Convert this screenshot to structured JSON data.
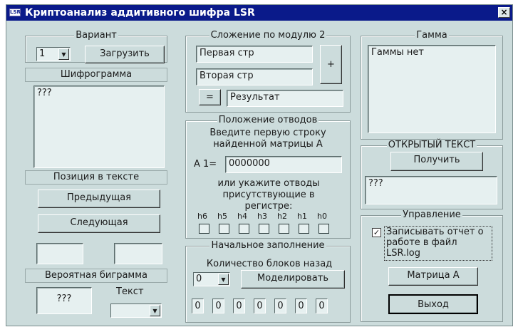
{
  "window": {
    "title": "Криптоанализ аддитивного шифра LSR",
    "icon_label": "LSR",
    "close_glyph": "×"
  },
  "variant": {
    "group_title": "Вариант",
    "selected": "1",
    "load_button": "Загрузить"
  },
  "ciphertext": {
    "label": "Шифрограмма",
    "value": "???"
  },
  "position": {
    "label": "Позиция в тексте",
    "prev_button": "Предыдущая",
    "next_button": "Следующая",
    "field_left": "",
    "field_right": ""
  },
  "bigram": {
    "label": "Вероятная биграмма",
    "value": "???",
    "text_label": "Текст",
    "text_selected": ""
  },
  "xor": {
    "group_title": "Сложение по модулю 2",
    "first": "Первая стр",
    "second": "Вторая стр",
    "plus_button": "+",
    "equals_button": "=",
    "result": "Результат"
  },
  "taps": {
    "group_title": "Положение отводов",
    "instruction": "Введите первую строку найденной матрицы А",
    "a1_label": "А 1=",
    "a1_value": "0000000",
    "or_text": "или укажите отводы присутствующие в регистре:",
    "bit_labels": [
      "h6",
      "h5",
      "h4",
      "h3",
      "h2",
      "h1",
      "h0"
    ]
  },
  "initial": {
    "group_title": "Начальное заполнение",
    "blocks_label": "Количество блоков назад",
    "blocks_selected": "0",
    "model_button": "Моделировать",
    "bits": [
      "0",
      "0",
      "0",
      "0",
      "0",
      "0",
      "0"
    ]
  },
  "gamma": {
    "group_title": "Гамма",
    "value": "Гаммы нет"
  },
  "plaintext": {
    "group_title": "ОТКРЫТЫЙ ТЕКСТ",
    "get_button": "Получить",
    "value": "???"
  },
  "control": {
    "group_title": "Управление",
    "log_checkbox_label": "Записывать отчет о работе в файл LSR.log",
    "log_checked": "✓",
    "matrix_button": "Матрица А",
    "exit_button": "Выход"
  }
}
